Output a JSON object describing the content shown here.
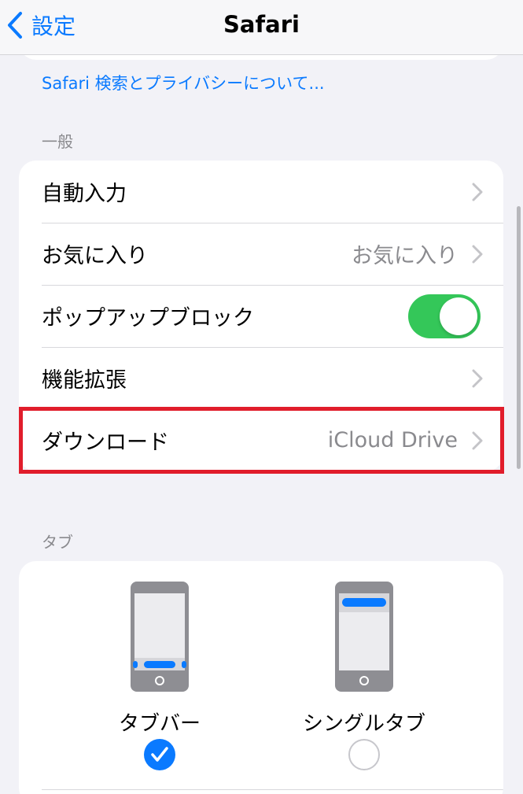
{
  "nav": {
    "back_label": "設定",
    "title": "Safari"
  },
  "privacy_link": "Safari 検索とプライバシーについて...",
  "general": {
    "section_label": "一般",
    "autofill": {
      "label": "自動入力"
    },
    "favorites": {
      "label": "お気に入り",
      "value": "お気に入り"
    },
    "popup_block": {
      "label": "ポップアップブロック",
      "enabled": true
    },
    "extensions": {
      "label": "機能拡張"
    },
    "downloads": {
      "label": "ダウンロード",
      "value": "iCloud Drive"
    }
  },
  "tabs": {
    "section_label": "タブ",
    "options": [
      {
        "label": "タブバー",
        "selected": true
      },
      {
        "label": "シングルタブ",
        "selected": false
      }
    ]
  },
  "colors": {
    "accent": "#0a7aff",
    "toggle_on": "#34c759",
    "highlight": "#e11d2b",
    "background": "#f2f2f7"
  }
}
